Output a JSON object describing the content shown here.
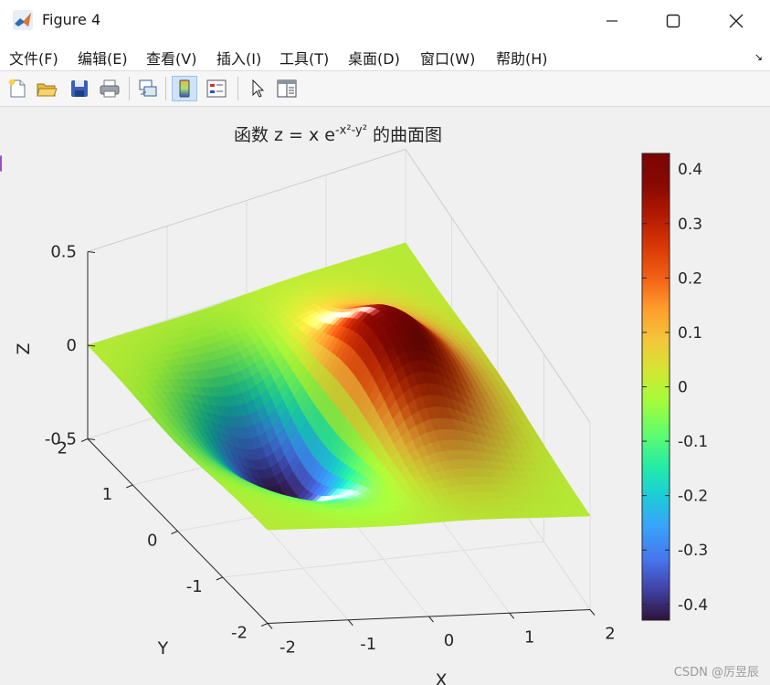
{
  "window": {
    "title": "Figure 4",
    "app_icon": "matlab-icon",
    "controls": [
      "minimize-icon",
      "maximize-icon",
      "close-icon"
    ]
  },
  "menu": [
    "文件(F)",
    "编辑(E)",
    "查看(V)",
    "插入(I)",
    "工具(T)",
    "桌面(D)",
    "窗口(W)",
    "帮助(H)"
  ],
  "menu_arrow": "↘",
  "toolbar": [
    "new-figure-icon",
    "open-file-icon",
    "save-icon",
    "print-icon",
    "link-plot-icon",
    "colorbar-icon",
    "legend-icon",
    "pointer-icon",
    "property-inspector-icon"
  ],
  "watermark": "CSDN @厉昱辰",
  "chart_data": {
    "type": "surface",
    "title_prefix": "函数 z = x e",
    "title_superscript": "-x²-y²",
    "title_suffix": "的曲面图",
    "function": "z = x*exp(-x^2-y^2)",
    "x": {
      "label": "X",
      "range": [
        -2,
        2
      ],
      "ticks": [
        "-2",
        "-1",
        "0",
        "1",
        "2"
      ]
    },
    "y": {
      "label": "Y",
      "range": [
        -2,
        2
      ],
      "ticks": [
        "-2",
        "-1",
        "0",
        "1",
        "2"
      ]
    },
    "z": {
      "label": "Z",
      "range": [
        -0.5,
        0.5
      ],
      "ticks": [
        "-0.5",
        "0",
        "0.5"
      ]
    },
    "z_min": -0.4289,
    "z_max": 0.4289,
    "colormap": "turbo",
    "shading": "interp",
    "grid": true,
    "colorbar": {
      "ticks": [
        "-0.4",
        "-0.3",
        "-0.2",
        "-0.1",
        "0",
        "0.1",
        "0.2",
        "0.3",
        "0.4"
      ],
      "range": [
        -0.4289,
        0.4289
      ]
    }
  }
}
